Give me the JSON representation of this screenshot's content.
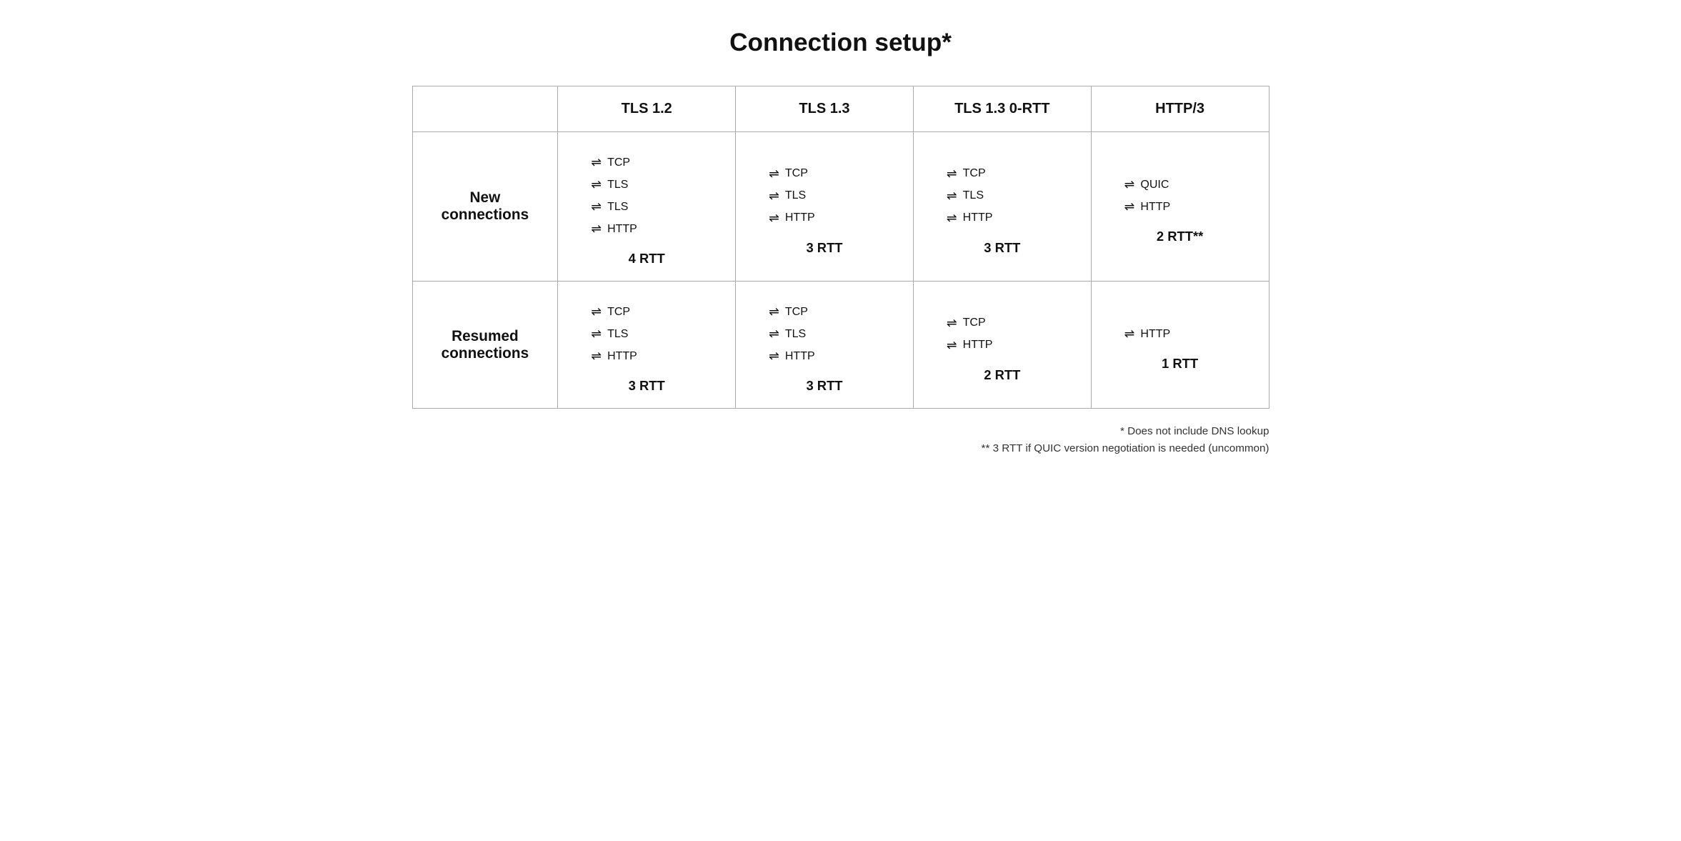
{
  "title": "Connection setup*",
  "columns": [
    {
      "id": "tls12",
      "label": "TLS 1.2"
    },
    {
      "id": "tls13",
      "label": "TLS 1.3"
    },
    {
      "id": "tls13_0rtt",
      "label": "TLS 1.3 0-RTT"
    },
    {
      "id": "http3",
      "label": "HTTP/3"
    }
  ],
  "rows": [
    {
      "label": "New\nconnections",
      "cells": [
        {
          "protocols": [
            "TCP",
            "TLS",
            "TLS",
            "HTTP"
          ],
          "rtt": "4 RTT"
        },
        {
          "protocols": [
            "TCP",
            "TLS",
            "HTTP"
          ],
          "rtt": "3 RTT"
        },
        {
          "protocols": [
            "TCP",
            "TLS",
            "HTTP"
          ],
          "rtt": "3 RTT"
        },
        {
          "protocols": [
            "QUIC",
            "HTTP"
          ],
          "rtt": "2 RTT**"
        }
      ]
    },
    {
      "label": "Resumed\nconnections",
      "cells": [
        {
          "protocols": [
            "TCP",
            "TLS",
            "HTTP"
          ],
          "rtt": "3 RTT"
        },
        {
          "protocols": [
            "TCP",
            "TLS",
            "HTTP"
          ],
          "rtt": "3 RTT"
        },
        {
          "protocols": [
            "TCP",
            "HTTP"
          ],
          "rtt": "2 RTT"
        },
        {
          "protocols": [
            "HTTP"
          ],
          "rtt": "1 RTT"
        }
      ]
    }
  ],
  "footnotes": [
    "* Does not include DNS lookup",
    "** 3 RTT if QUIC version negotiation is needed (uncommon)"
  ]
}
